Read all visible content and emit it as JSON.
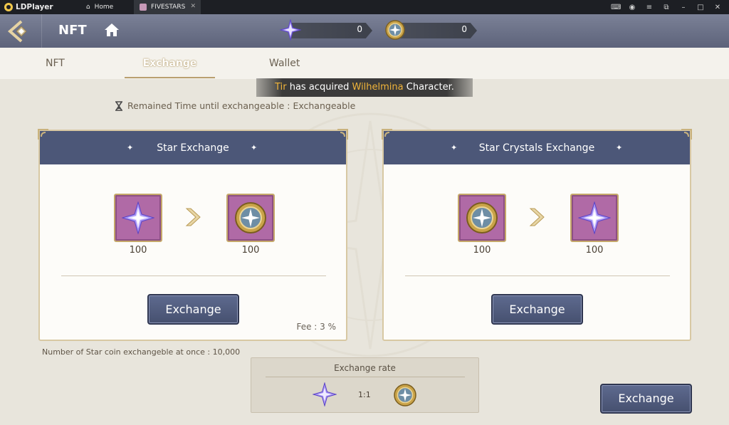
{
  "emulator": {
    "app_name": "LDPlayer",
    "tabs": [
      {
        "label": "Home"
      },
      {
        "label": "FIVESTARS"
      }
    ]
  },
  "header": {
    "title": "NFT",
    "currencies": [
      {
        "icon": "star-crystal-icon",
        "value": "0"
      },
      {
        "icon": "star-coin-icon",
        "value": "0"
      }
    ]
  },
  "tabs": {
    "items": [
      {
        "label": "NFT"
      },
      {
        "label": "Exchange"
      },
      {
        "label": "Wallet"
      }
    ],
    "active": "Exchange"
  },
  "notice": {
    "player": "Tir",
    "middle": " has acquired ",
    "character": "Wilhelmina",
    "suffix": " Character."
  },
  "timer": {
    "text": "Remained Time until exchangeable : Exchangeable"
  },
  "cards": {
    "star_exchange": {
      "title": "Star Exchange",
      "from_icon": "star-crystal-icon",
      "from_amount": "100",
      "to_icon": "star-coin-icon",
      "to_amount": "100",
      "button": "Exchange",
      "fee": "Fee :  3 %"
    },
    "crystal_exchange": {
      "title": "Star Crystals Exchange",
      "from_icon": "star-coin-icon",
      "from_amount": "100",
      "to_icon": "star-crystal-icon",
      "to_amount": "100",
      "button": "Exchange"
    }
  },
  "limit_text": "Number of Star coin exchangeble at once : 10,000",
  "rate": {
    "title": "Exchange rate",
    "value": "1:1"
  },
  "main_button": "Exchange",
  "colors": {
    "header_bg": "#5d637a",
    "card_header": "#4c5778",
    "button": "#4f5a7d",
    "item_bg": "#b06aa6",
    "gold": "#c5a86a",
    "highlight": "#f0b43a"
  }
}
